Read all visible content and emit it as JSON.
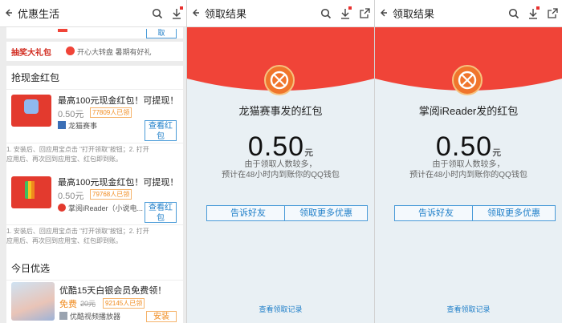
{
  "screens": [
    {
      "title": "优惠生活",
      "banner": {
        "logo_text": "抽奖大礼包",
        "promo": "开心大转盘 暑期有好礼",
        "top_button": "取"
      },
      "section1": {
        "heading": "抢现金红包",
        "items": [
          {
            "title": "最高100元现金红包！可提现！",
            "price": "0.50元",
            "count": "77809人已领",
            "source": "龙猫赛事",
            "button": "查看红包",
            "desc1": "1. 安装后、回应用宝点击 \"打开领取\"按钮；2. 打开",
            "desc2": "应用后、再次回到应用宝、红包即到账。"
          },
          {
            "title": "最高100元现金红包！可提现！",
            "price": "0.50元",
            "count": "79768人已领",
            "source": "掌阅iReader（小说电...",
            "button": "查看红包",
            "desc1": "1. 安装后、回应用宝点击 \"打开领取\"按钮；2. 打开",
            "desc2": "应用后、再次回到应用宝、红包即到账。"
          }
        ]
      },
      "section2": {
        "heading": "今日优选",
        "item": {
          "title": "优酷15天白银会员免费领！",
          "price_free": "免费",
          "price_orig": "20元",
          "count": "92145人已领",
          "source": "优酷视频播放器",
          "button": "安装"
        }
      }
    },
    {
      "title": "领取结果",
      "from": "龙猫赛事发的红包",
      "amount": "0.50",
      "unit": "元",
      "note1": "由于领取人数较多，",
      "note2": "预计在48小时内到账你的QQ钱包",
      "btn_share": "告诉好友",
      "btn_more": "领取更多优惠",
      "records": "查看领取记录"
    },
    {
      "title": "领取结果",
      "from": "掌阅iReader发的红包",
      "amount": "0.50",
      "unit": "元",
      "note1": "由于领取人数较多，",
      "note2": "预计在48小时内到账你的QQ钱包",
      "btn_share": "告诉好友",
      "btn_more": "领取更多优惠",
      "records": "查看领取记录"
    }
  ],
  "colors": {
    "red": "#f04438",
    "blue": "#1e7ec8",
    "orange": "#f08a1c",
    "bg": "#e9f0f4"
  },
  "icons": [
    "back-arrow-icon",
    "search-icon",
    "download-icon",
    "share-icon",
    "coin-icon"
  ]
}
